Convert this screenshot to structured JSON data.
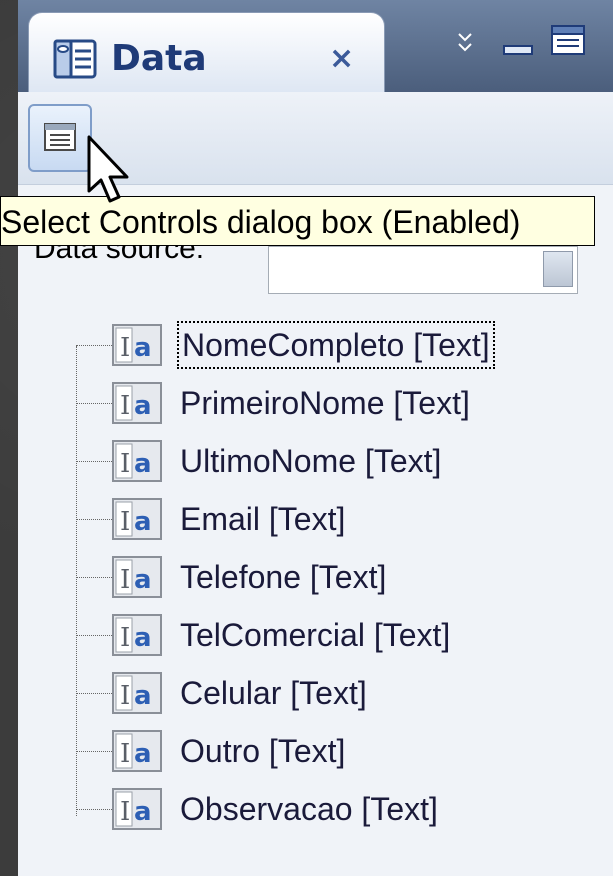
{
  "panel": {
    "tab": {
      "label": "Data",
      "close_symbol": "×",
      "icon": "data-source-icon"
    },
    "menu_chevron": "»",
    "toolbar": {
      "select_controls_button_icon": "select-controls-icon"
    },
    "tooltip": "Select Controls dialog box (Enabled)",
    "data_source": {
      "label": "Data source:",
      "value": ""
    },
    "tree": {
      "items": [
        {
          "label": "NomeCompleto [Text]",
          "selected": true
        },
        {
          "label": "PrimeiroNome [Text]",
          "selected": false
        },
        {
          "label": "UltimoNome [Text]",
          "selected": false
        },
        {
          "label": "Email [Text]",
          "selected": false
        },
        {
          "label": "Telefone [Text]",
          "selected": false
        },
        {
          "label": "TelComercial [Text]",
          "selected": false
        },
        {
          "label": "Celular [Text]",
          "selected": false
        },
        {
          "label": "Outro [Text]",
          "selected": false
        },
        {
          "label": "Observacao [Text]",
          "selected": false
        }
      ]
    }
  },
  "colors": {
    "title_strip": "#5a6f8f",
    "tab_text": "#1f3b78",
    "tooltip_bg": "#ffffe1",
    "tree_text": "#1a1a3a"
  }
}
